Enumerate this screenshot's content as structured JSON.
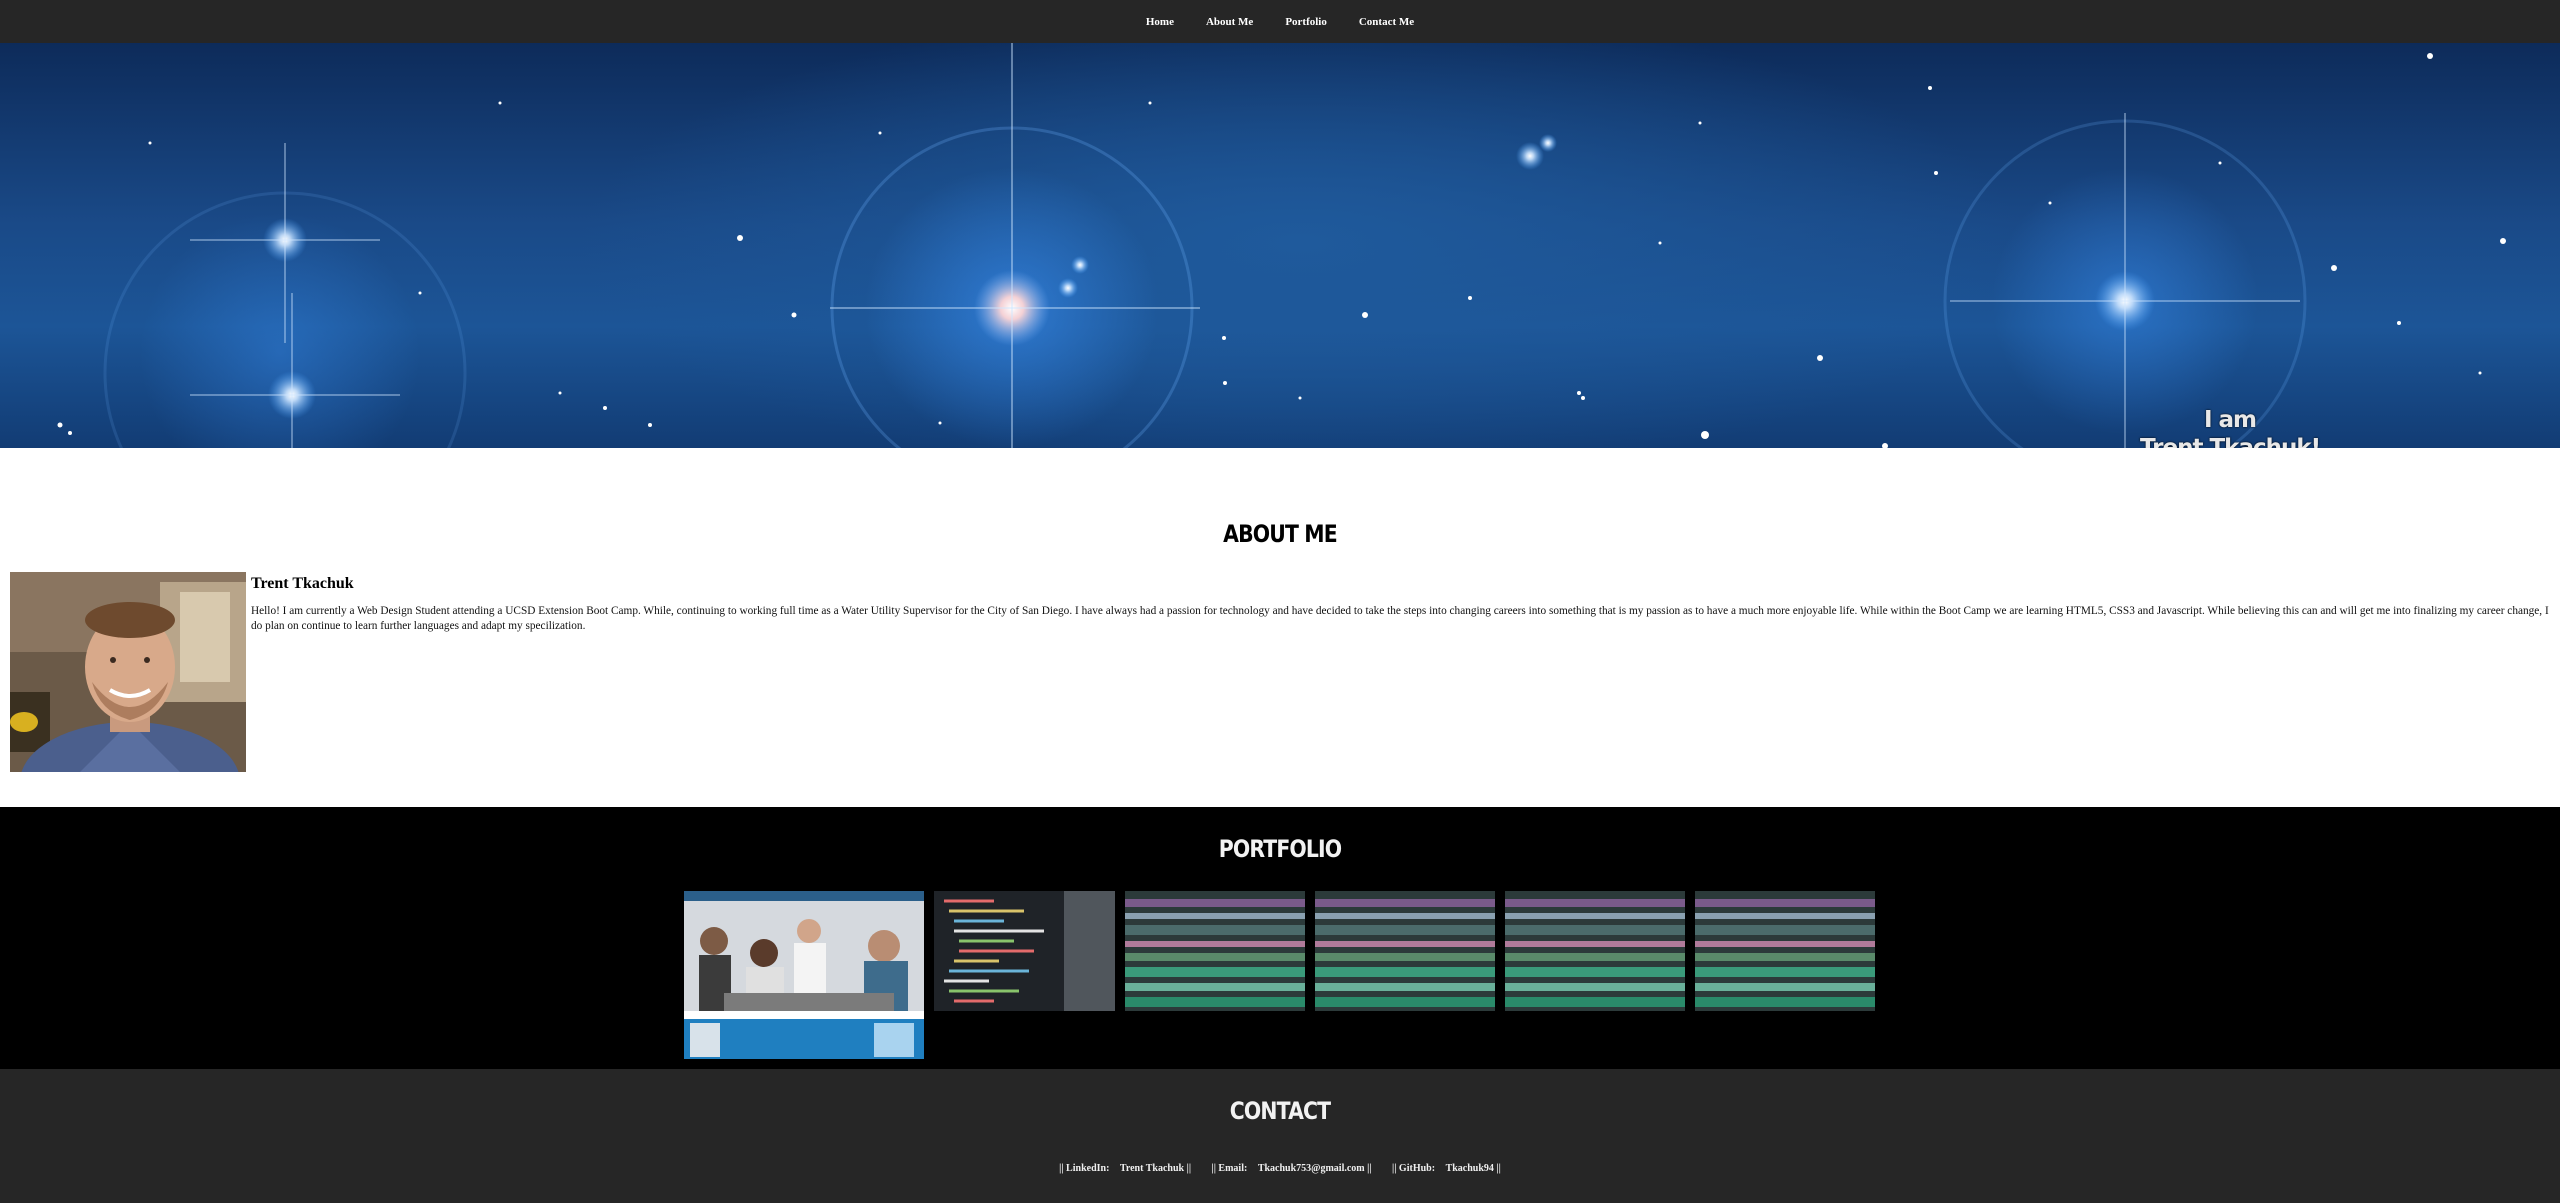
{
  "nav": {
    "items": [
      "Home",
      "About Me",
      "Portfolio",
      "Contact Me"
    ]
  },
  "hero": {
    "line1": "I am",
    "line2": "Trent Tkachuk!"
  },
  "about": {
    "title": "ABOUT ME",
    "name": "Trent Tkachuk",
    "text": "Hello! I am currently a Web Design Student attending a UCSD Extension Boot Camp. While, continuing to working full time as a Water Utility Supervisor for the City of San Diego. I have always had a passion for technology and have decided to take the steps into changing careers into something that is my passion as to have a much more enjoyable life. While within the Boot Camp we are learning HTML5, CSS3 and Javascript. While believing this can and will get me into finalizing my career change, I do plan on continue to learn further languages and adapt my specilization."
  },
  "portfolio": {
    "title": "PORTFOLIO"
  },
  "contact": {
    "title": "CONTACT",
    "linkedin_label": "|| LinkedIn:",
    "linkedin_value": "Trent Tkachuk ||",
    "email_label": "|| Email:",
    "email_value": "Tkachuk753@gmail.com ||",
    "github_label": "|| GitHub:",
    "github_value": "Tkachuk94 ||"
  },
  "colors": {
    "nav_bg": "#262626",
    "portfolio_bg": "#000000",
    "contact_bg": "#262626"
  }
}
